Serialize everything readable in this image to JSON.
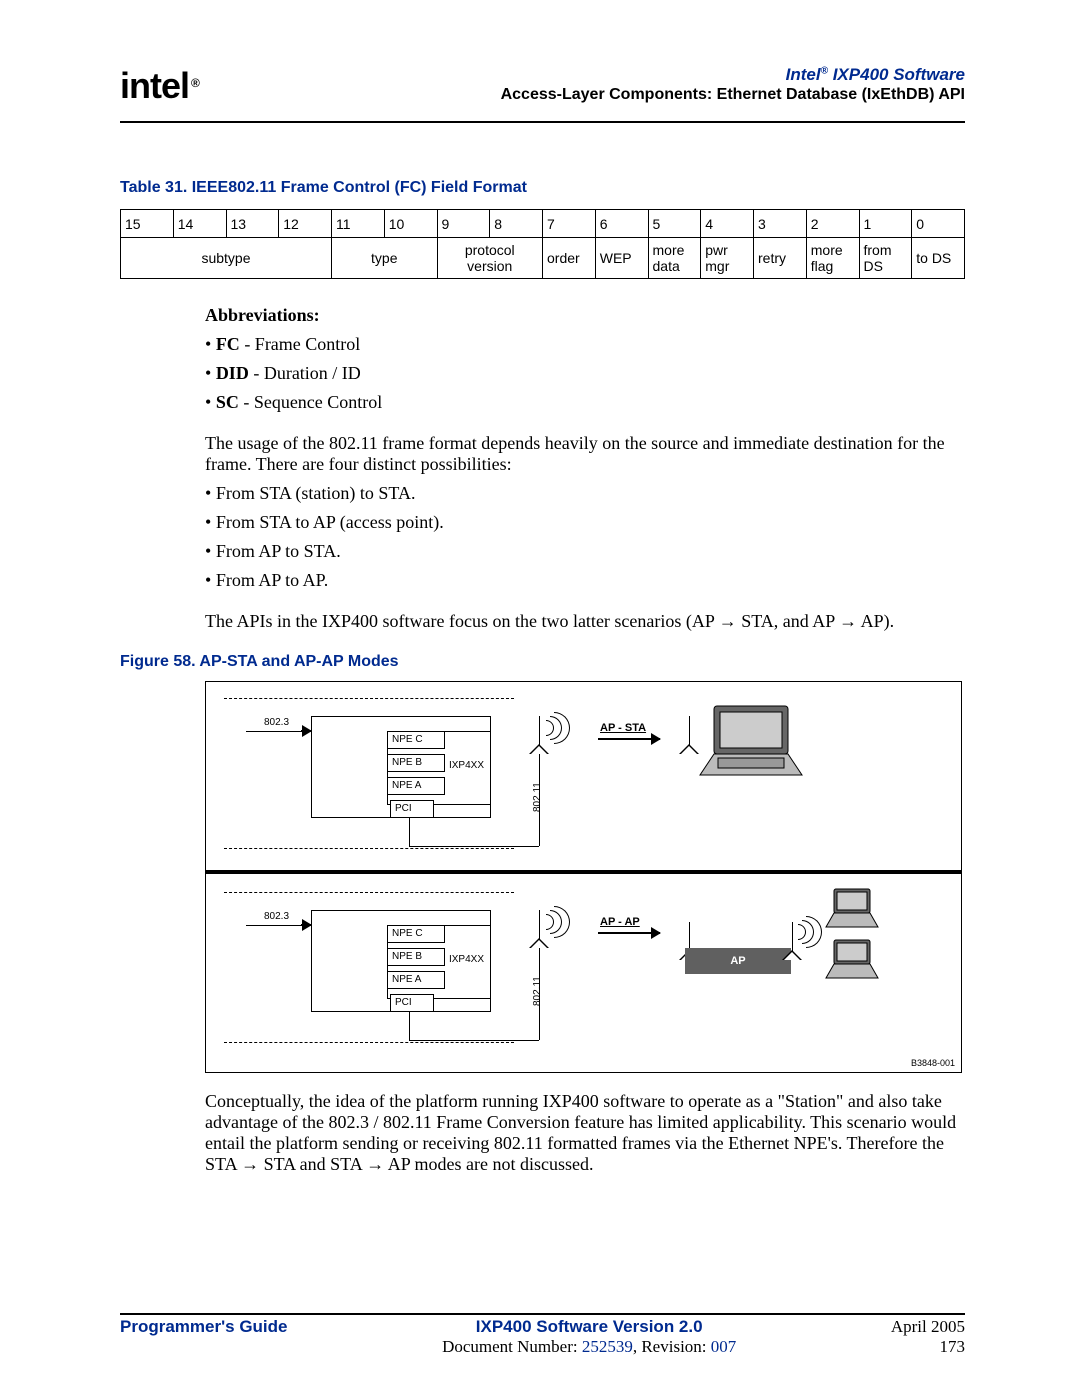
{
  "header": {
    "logo_text": "intel",
    "reg": "®",
    "product": "Intel",
    "product_suffix": " IXP400 Software",
    "chapter": "Access-Layer Components: Ethernet Database (IxEthDB) API"
  },
  "table": {
    "title": "Table 31.  IEEE802.11 Frame Control (FC) Field Format",
    "bits": [
      "15",
      "14",
      "13",
      "12",
      "11",
      "10",
      "9",
      "8",
      "7",
      "6",
      "5",
      "4",
      "3",
      "2",
      "1",
      "0"
    ],
    "fields": [
      {
        "label": "subtype",
        "span": 4
      },
      {
        "label": "type",
        "span": 2
      },
      {
        "label": "protocol version",
        "span": 2
      },
      {
        "label": "order",
        "span": 1
      },
      {
        "label": "WEP",
        "span": 1
      },
      {
        "label": "more data",
        "span": 1
      },
      {
        "label": "pwr mgr",
        "span": 1
      },
      {
        "label": "retry",
        "span": 1
      },
      {
        "label": "more flag",
        "span": 1
      },
      {
        "label": "from DS",
        "span": 1
      },
      {
        "label": "to DS",
        "span": 1
      }
    ]
  },
  "abbr": {
    "heading": "Abbreviations:",
    "items": [
      {
        "b": "FC",
        "t": " - Frame Control"
      },
      {
        "b": "DID",
        "t": " - Duration / ID"
      },
      {
        "b": "SC",
        "t": " - Sequence Control"
      }
    ]
  },
  "para1": "The usage of the 802.11 frame format depends heavily on the source and immediate destination for the frame.  There are four distinct possibilities:",
  "poss": [
    "From STA (station) to STA.",
    "From STA to AP (access point).",
    "From AP to STA.",
    "From AP to AP."
  ],
  "para2": "The APIs in the IXP400 software focus on the two latter scenarios (AP → STA, and AP → AP).",
  "figure": {
    "title": "Figure 58. AP-STA and AP-AP Modes",
    "eth_label": "802.3",
    "npe": [
      "NPE C",
      "NPE B",
      "NPE A"
    ],
    "ixp": "IXP4XX",
    "pci": "PCI",
    "vert_label": "802.11",
    "mode1": "AP - STA",
    "mode2": "AP - AP",
    "ap_label": "AP",
    "id": "B3848-001"
  },
  "para3": "Conceptually, the idea of the platform running IXP400 software to operate as a \"Station\" and also take advantage of the 802.3 / 802.11 Frame Conversion feature has limited applicability. This scenario would entail the platform sending or receiving 802.11 formatted frames via the Ethernet NPE's. Therefore the STA → STA and STA → AP modes are not discussed.",
  "footer": {
    "left": "Programmer's Guide",
    "mid_top": "IXP400 Software Version 2.0",
    "mid_bot_pre": "Document Number: ",
    "docnum": "252539",
    "mid_bot_mid": ", Revision: ",
    "rev": "007",
    "date": "April 2005",
    "page": "173"
  },
  "chart_data": {
    "type": "table",
    "title": "IEEE802.11 Frame Control (FC) Field Format",
    "bit_positions": [
      15,
      14,
      13,
      12,
      11,
      10,
      9,
      8,
      7,
      6,
      5,
      4,
      3,
      2,
      1,
      0
    ],
    "fields": [
      {
        "name": "subtype",
        "bits": "15-12",
        "width": 4
      },
      {
        "name": "type",
        "bits": "11-10",
        "width": 2
      },
      {
        "name": "protocol version",
        "bits": "9-8",
        "width": 2
      },
      {
        "name": "order",
        "bits": "7",
        "width": 1
      },
      {
        "name": "WEP",
        "bits": "6",
        "width": 1
      },
      {
        "name": "more data",
        "bits": "5",
        "width": 1
      },
      {
        "name": "pwr mgr",
        "bits": "4",
        "width": 1
      },
      {
        "name": "retry",
        "bits": "3",
        "width": 1
      },
      {
        "name": "more flag",
        "bits": "2",
        "width": 1
      },
      {
        "name": "from DS",
        "bits": "1",
        "width": 1
      },
      {
        "name": "to DS",
        "bits": "0",
        "width": 1
      }
    ]
  }
}
